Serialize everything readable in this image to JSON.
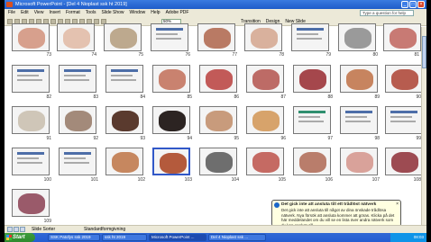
{
  "window": {
    "title": "Microsoft PowerPoint - [Del 4 Nioplast ssk ht 2019]"
  },
  "menu": {
    "items": [
      "File",
      "Edit",
      "View",
      "Insert",
      "Format",
      "Tools",
      "Slide Show",
      "Window",
      "Help",
      "Adobe PDF"
    ],
    "help_placeholder": "Type a question for help"
  },
  "toolbar": {
    "zoom": "50%",
    "transition": "Transition",
    "design": "Design",
    "new_slide": "New Slide"
  },
  "slides": {
    "row1": [
      "73",
      "74",
      "75",
      "76",
      "77",
      "78",
      "79",
      "80",
      "81"
    ],
    "row2": [
      "82",
      "83",
      "84",
      "85",
      "86",
      "87",
      "88",
      "89",
      "90"
    ],
    "row3": [
      "91",
      "92",
      "93",
      "94",
      "95",
      "96",
      "97",
      "98",
      "99"
    ],
    "row4": [
      "100",
      "101",
      "102",
      "103",
      "104",
      "105",
      "106",
      "107",
      "108"
    ],
    "row5": [
      "109"
    ]
  },
  "statusbar": {
    "view": "Slide Sorter",
    "design": "Standardformgivning"
  },
  "balloon": {
    "title": "Det gick inte att ansluta till ett trådlöst nätverk",
    "body": "Det gick inte att ansluta till något av dina önskade trådlösa nätverk. Nya försök att ansluta kommer att göras. Klicka på det här meddelandet om du vill se en lista över andra nätverk som du kan ansluta till."
  },
  "taskbar": {
    "start": "Start",
    "items": [
      "SSK Patofys ssk 2019",
      "ssk ht 2019",
      "Microsoft PowerPoint ...",
      "Del 4 Nioplast ssk ..."
    ],
    "clock": "08:03"
  },
  "colors": {
    "title_bar": "#1f5cc9",
    "taskbar": "#245dd2",
    "start": "#3c9c3c",
    "chrome": "#ece9d8",
    "balloon": "#ffffe1"
  }
}
